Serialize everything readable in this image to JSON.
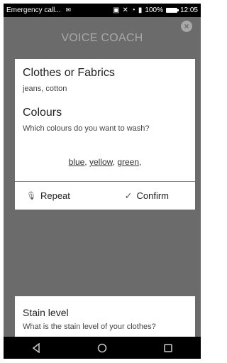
{
  "statusbar": {
    "left_text": "Emergency call...",
    "sms_icon": "message-icon",
    "right_text": "100%",
    "time": "12:05"
  },
  "header": {
    "title": "VOICE COACH",
    "close_icon": "close-icon"
  },
  "card": {
    "section1_title": "Clothes or Fabrics",
    "section1_value": "jeans, cotton",
    "section2_title": "Colours",
    "section2_question": "Which colours do you want to wash?",
    "answers": [
      "blue",
      "yellow",
      "green"
    ],
    "repeat_label": "Repeat",
    "confirm_label": "Confirm"
  },
  "stain": {
    "title": "Stain level",
    "question": "What is the stain level of your clothes?"
  },
  "navbar": {
    "back_icon": "back-triangle-icon",
    "home_icon": "home-circle-icon",
    "recents_icon": "recents-square-icon"
  }
}
